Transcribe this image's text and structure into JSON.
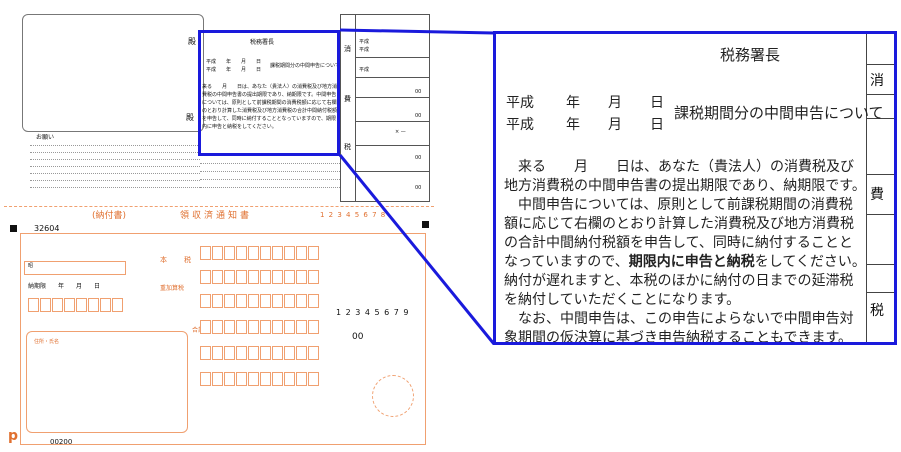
{
  "left_form": {
    "upper_right_title": "税務署長",
    "address_block_char": "殿",
    "notice_date_1": "平成　　年　　月　　日",
    "notice_date_2": "平成　　年　　月　　日",
    "notice_subject": "課税期間分の中間申告について",
    "notice_body_small": "来る　　月　　日は、あなた（貴法人）の消費税及び地方消費税の中間申告書の提出期限であり、納期限です。中間申告については、原則として前課税期間の消費税額に応じて右欄のとおり計算した消費税及び地方消費税の合計中間納付税額を申告して、同時に納付することとなっていますので、期限内に申告と納税をしてください。",
    "attention_header": "お願い",
    "side_labels": [
      "消",
      "費",
      "税"
    ],
    "right_table_rows": [
      "平成",
      "平成",
      "平成"
    ],
    "zero_val": "00",
    "minus_sign": "× —",
    "form_name": "領収済通知書",
    "form_label_left": "(納付書)",
    "bureau_no": "32604",
    "digits_row": "1 2 3 4 5 6 7 8",
    "code_digits": "1 2 3 4 5 6 7 9",
    "reiwa": "昭",
    "payment_due": "納期限　　年　　月　　日",
    "bottom_code": "00200",
    "kanji_hon": "本",
    "kanji_zei": "税",
    "jyuusan": "重加算税",
    "gokei": "合計",
    "taxpayer_note": "住所・氏名",
    "p_logo": "p"
  },
  "zoom": {
    "title": "税務署長",
    "date_line_1": [
      "平成",
      "年",
      "月",
      "日"
    ],
    "date_line_2": [
      "平成",
      "年",
      "月",
      "日"
    ],
    "subject": "課税期間分の中間申告について",
    "body_lines": [
      "来る　　月　　日は、あなた（貴法人）の消費税及び",
      "地方消費税の中間申告書の提出期限であり、納期限です。",
      "中間申告については、原則として前課税期間の消費税",
      "額に応じて右欄のとおり計算した消費税及び地方消費税",
      "の合計中間納付税額を申告して、同時に納付することと",
      "なっていますので、期限内に申告と納税をしてください。",
      "納付が遅れますと、本税のほかに納付の日までの延滞税",
      "を納付していただくことになります。",
      "なお、中間申告は、この申告によらないで中間申告対",
      "象期間の仮決算に基づき申告納税することもできます。"
    ],
    "bold_phrase": "期限内に申告と納税",
    "side_chars": [
      "消",
      "費",
      "税"
    ]
  },
  "colors": {
    "highlight": "#1a1adc",
    "form_orange": "#f0a070",
    "text": "#111111"
  }
}
